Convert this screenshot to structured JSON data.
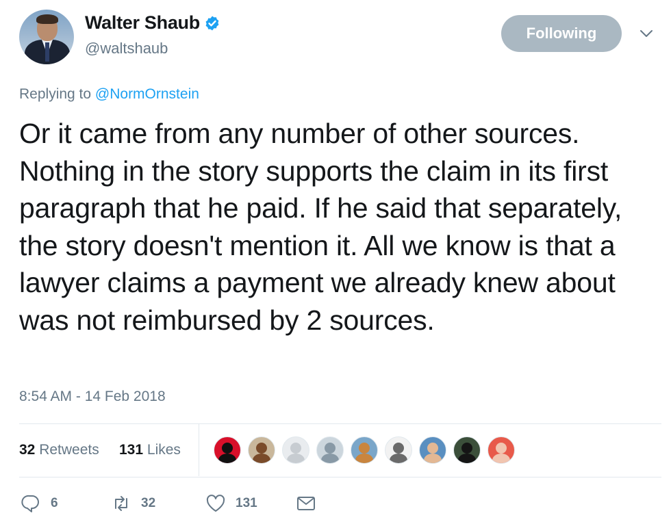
{
  "author": {
    "name": "Walter Shaub",
    "handle": "@waltshaub",
    "verified": true,
    "follow_button_label": "Following"
  },
  "reply": {
    "prefix": "Replying to",
    "mention": "@NormOrnstein"
  },
  "tweet": {
    "text": "Or it came from any number of other sources. Nothing in the story supports the claim in its first paragraph that he paid. If he said that separately, the story doesn't mention it. All we know is that a lawyer claims a payment we already knew about was not reimbursed by 2 sources.",
    "timestamp": "8:54 AM - 14 Feb 2018"
  },
  "stats": {
    "retweets_count": "32",
    "retweets_label": "Retweets",
    "likes_count": "131",
    "likes_label": "Likes"
  },
  "likers": [
    {
      "bg": "#d8102a",
      "fg": "#111111"
    },
    {
      "bg": "#c9b79b",
      "fg": "#7a4b2a"
    },
    {
      "bg": "#e9ecef",
      "fg": "#c7ccd1"
    },
    {
      "bg": "#ccd6dd",
      "fg": "#8899a6"
    },
    {
      "bg": "#7aa6c9",
      "fg": "#c9853e"
    },
    {
      "bg": "#f2f2f2",
      "fg": "#6a6a6a"
    },
    {
      "bg": "#5a8fc0",
      "fg": "#e3b894"
    },
    {
      "bg": "#3b4f3a",
      "fg": "#151515"
    },
    {
      "bg": "#e85a4a",
      "fg": "#f1c5b0"
    }
  ],
  "actions": {
    "replies": "6",
    "retweets": "32",
    "likes": "131"
  },
  "colors": {
    "accent": "#1da1f2",
    "muted": "#657786",
    "text": "#14171a",
    "following_button": "#aab8c2",
    "divider": "#e1e8ed"
  },
  "icons": {
    "verified": "verified-badge-icon",
    "menu": "chevron-down-icon",
    "reply": "reply-icon",
    "retweet": "retweet-icon",
    "like": "heart-icon",
    "dm": "envelope-icon"
  }
}
